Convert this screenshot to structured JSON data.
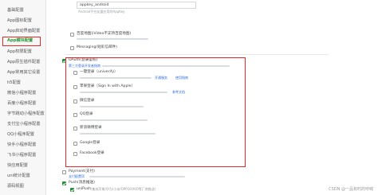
{
  "sidebar": {
    "items": [
      {
        "label": "基础配置",
        "active": false
      },
      {
        "label": "App图标配置",
        "active": false
      },
      {
        "label": "App启动界面配置",
        "active": false
      },
      {
        "label": "App模块配置",
        "active": true
      },
      {
        "label": "App权限配置",
        "active": false
      },
      {
        "label": "App原生插件配置",
        "active": false
      },
      {
        "label": "App常用其它设置",
        "active": false
      },
      {
        "label": "h5配置",
        "active": false
      },
      {
        "label": "微信小程序配置",
        "active": false
      },
      {
        "label": "百度小程序配置",
        "active": false
      },
      {
        "label": "字节跳动小程序配置",
        "active": false
      },
      {
        "label": "支付宝小程序配置",
        "active": false
      },
      {
        "label": "QQ小程序配置",
        "active": false
      },
      {
        "label": "快手小程序配置",
        "active": false
      },
      {
        "label": "飞书小程序配置",
        "active": false
      },
      {
        "label": "快应用配置",
        "active": false
      },
      {
        "label": "uni统计配置",
        "active": false
      },
      {
        "label": "源码视图",
        "active": false
      }
    ]
  },
  "main": {
    "top_field_value": "appkey_android",
    "top_field_hint": "Android平台友盟应用的AppKey",
    "options": {
      "baidu_push": {
        "label": "百度地图(iVideo不支持百度地图)",
        "checked": false
      },
      "messaging": {
        "label": "Messaging(短彩信邮件)",
        "checked": false
      },
      "oauth": {
        "label": "OAuth(登录鉴权)",
        "checked": true,
        "link": "第三方登录开发者指南"
      },
      "payment": {
        "label": "Payment(支付)",
        "checked": false,
        "link": "支付配置项"
      },
      "push": {
        "label": "Push(消息推送)",
        "checked": true
      },
      "unipush": {
        "label": "uniPush",
        "checked": true,
        "note": "(集成苹果/华为/小米/OPPO/VIVO等厂商推送)"
      }
    },
    "login_providers": [
      {
        "label": "一键登录（univerify）",
        "checked": false,
        "links": [
          "开通服务",
          "使用指南"
        ]
      },
      {
        "label": "苹果登录（Sign In with Apple）",
        "checked": false,
        "links": [
          "参考文档"
        ]
      },
      {
        "label": "微信登录",
        "checked": false,
        "links": []
      },
      {
        "label": "QQ登录",
        "checked": false,
        "links": []
      },
      {
        "label": "新浪微博登录",
        "checked": false,
        "links": []
      },
      {
        "label": "Google登录",
        "checked": false,
        "links": []
      },
      {
        "label": "Facebook登录",
        "checked": false,
        "links": []
      }
    ]
  },
  "watermark": "CSDN @一品有时的呼喊",
  "colors": {
    "accent_green": "#2a8d3c",
    "highlight_red": "#e02b2b",
    "link_blue": "#2f6bd6"
  }
}
